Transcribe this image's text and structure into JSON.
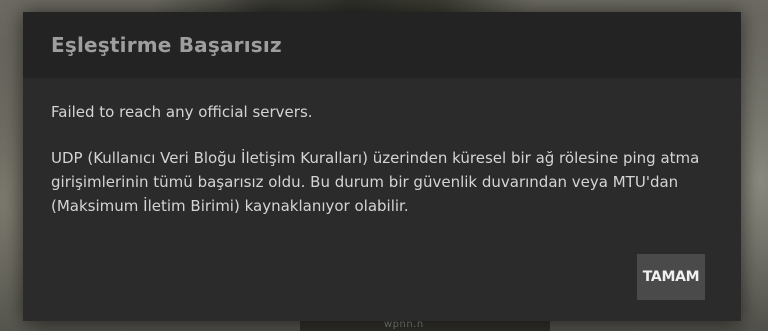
{
  "background": {
    "watermark": "wpnn.n"
  },
  "dialog": {
    "title": "Eşleştirme Başarısız",
    "message_short": "Failed to reach any official servers.",
    "message_long": "UDP (Kullanıcı Veri Bloğu İletişim Kuralları) üzerinden küresel bir ağ rölesine ping atma girişimlerinin tümü başarısız oldu. Bu durum bir güvenlik duvarından veya MTU'dan (Maksimum İletim Birimi) kaynaklanıyor olabilir.",
    "ok_label": "TAMAM"
  },
  "colors": {
    "dialog_bg": "#2b2b2b",
    "header_bg": "#232323",
    "title_text": "#9e9e9e",
    "body_text": "#d4d4d4",
    "button_bg": "#4a4a4a",
    "button_text": "#f0f0f0"
  }
}
